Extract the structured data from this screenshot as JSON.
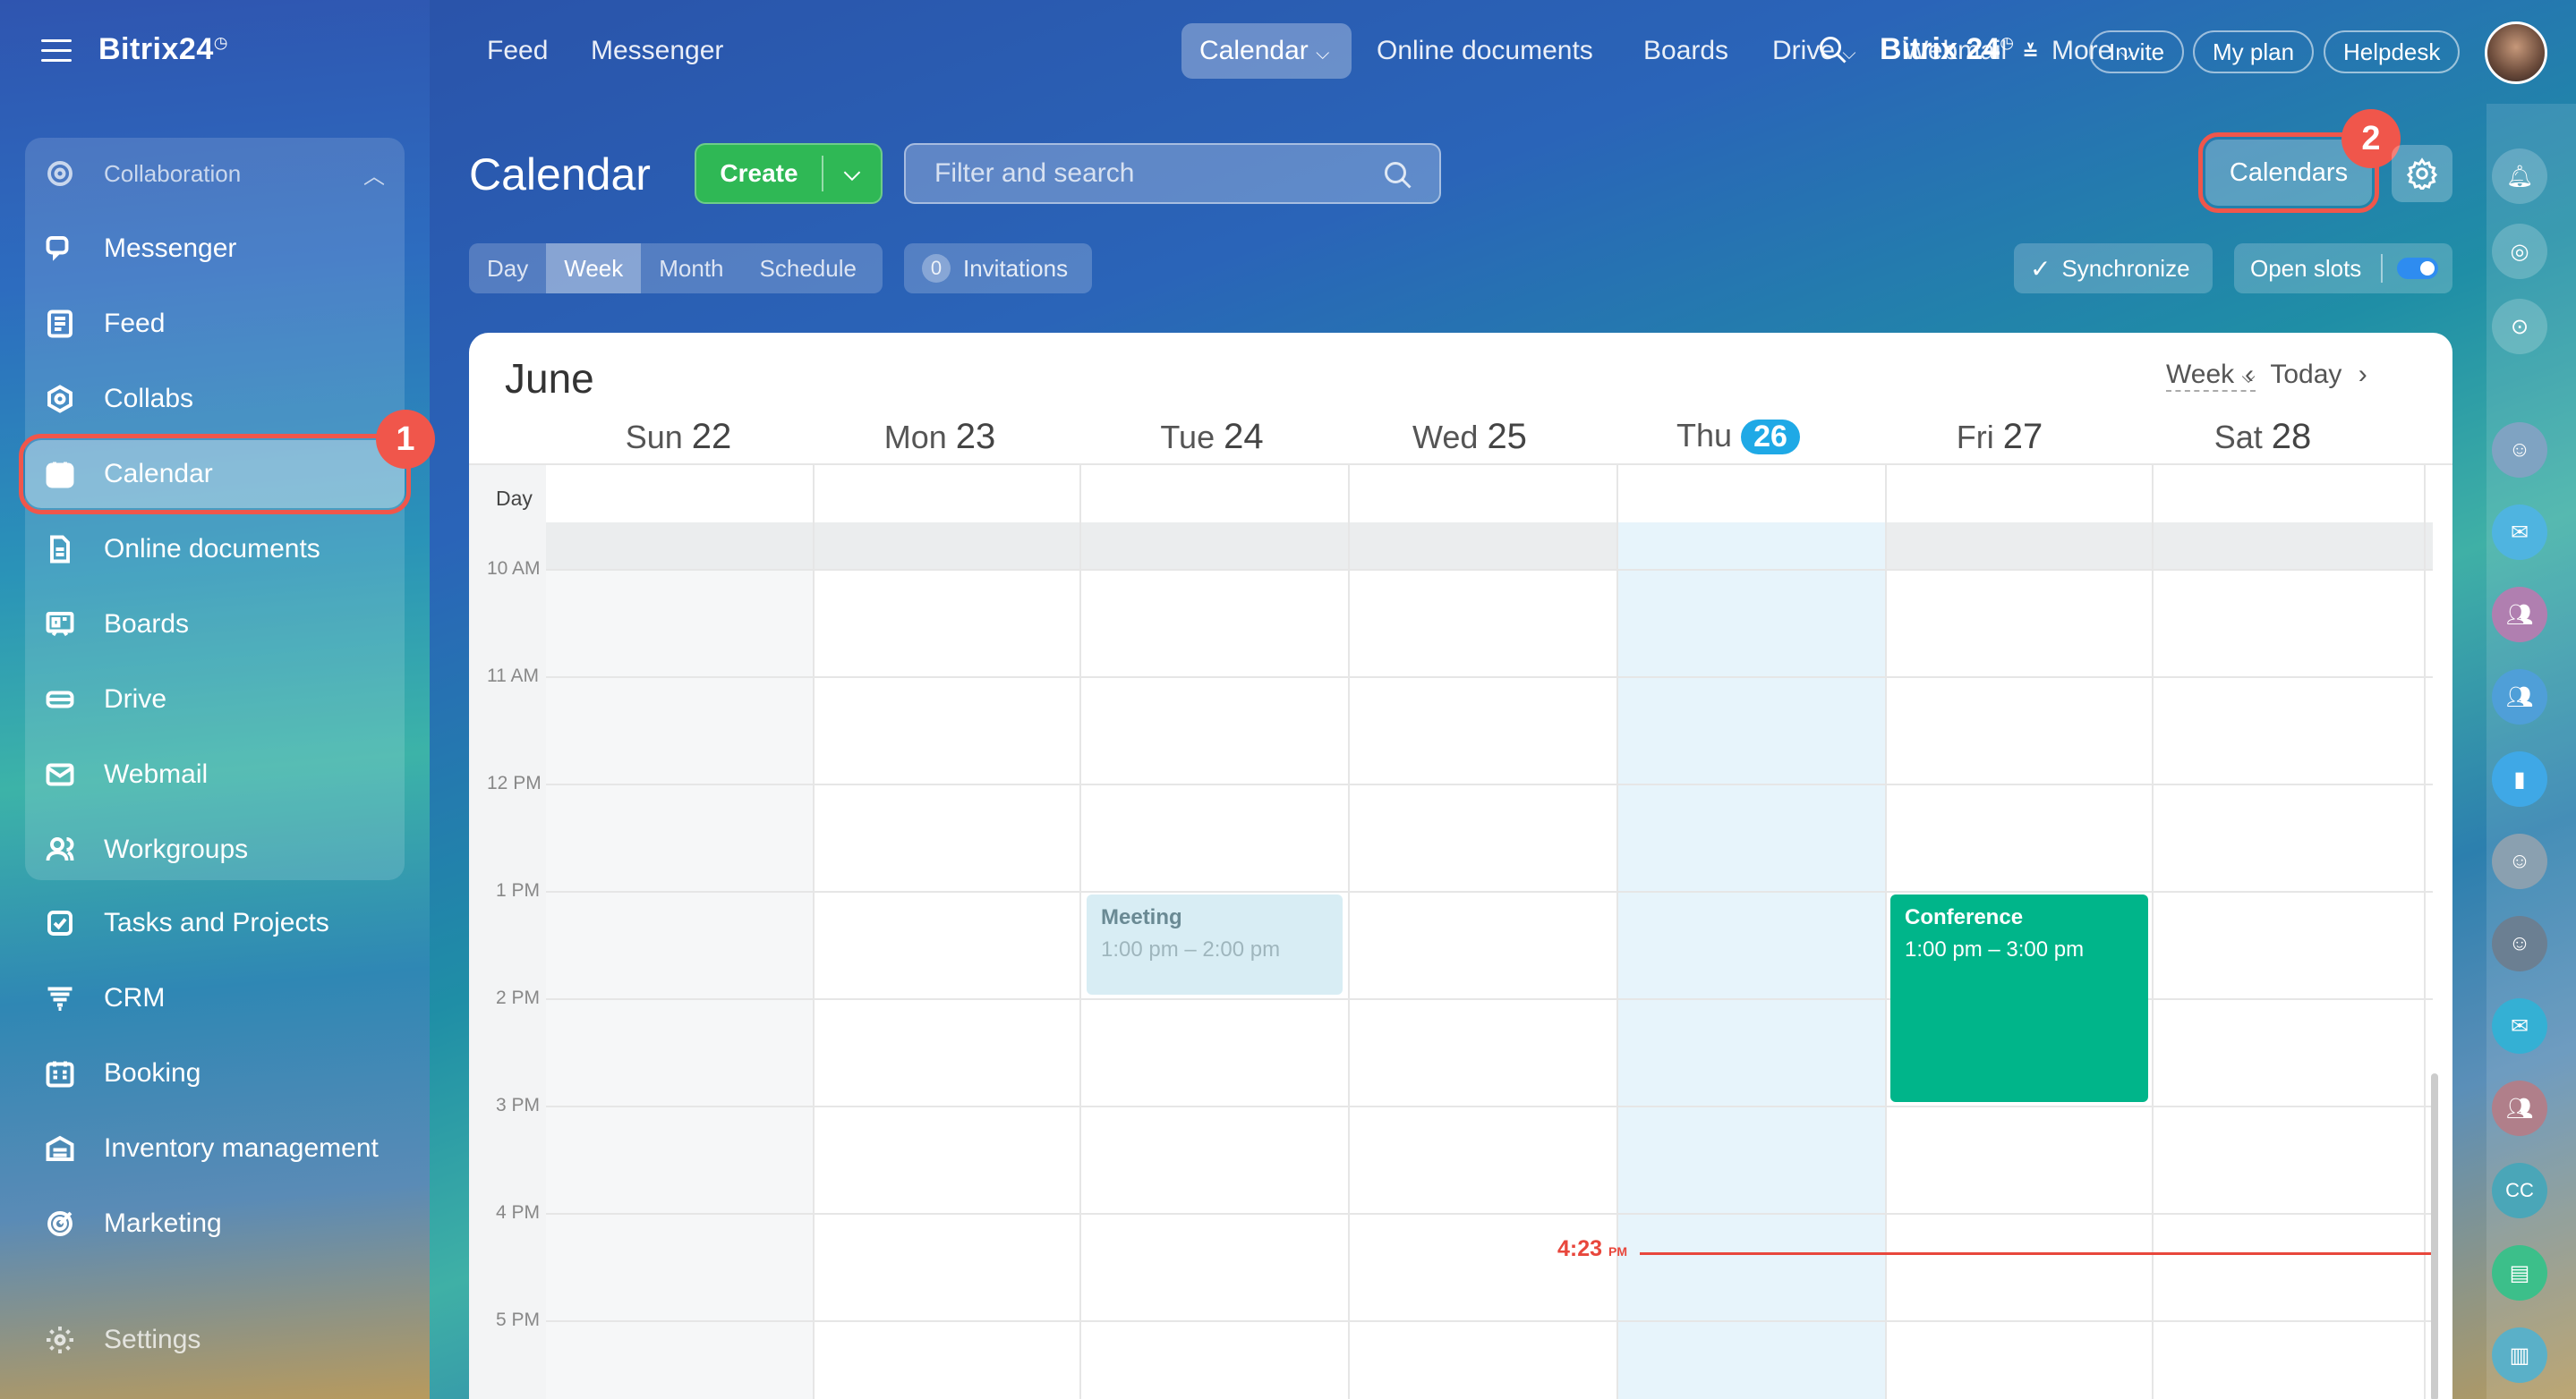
{
  "app": {
    "brand": "Bitrix24"
  },
  "top_nav": {
    "links": [
      "Feed",
      "Messenger",
      "Calendar",
      "Online documents",
      "Boards",
      "Drive",
      "Webmail",
      "More"
    ],
    "brand_right": "Bitrix 24",
    "invite": "Invite",
    "my_plan": "My plan",
    "helpdesk": "Helpdesk"
  },
  "sidebar": {
    "group_label": "Collaboration",
    "items": [
      {
        "label": "Messenger",
        "icon": "chat-icon"
      },
      {
        "label": "Feed",
        "icon": "feed-icon"
      },
      {
        "label": "Collabs",
        "icon": "collabs-icon"
      },
      {
        "label": "Calendar",
        "icon": "calendar-icon"
      },
      {
        "label": "Online documents",
        "icon": "document-icon"
      },
      {
        "label": "Boards",
        "icon": "boards-icon"
      },
      {
        "label": "Drive",
        "icon": "drive-icon"
      },
      {
        "label": "Webmail",
        "icon": "mail-icon"
      },
      {
        "label": "Workgroups",
        "icon": "workgroups-icon"
      },
      {
        "label": "Tasks and Projects",
        "icon": "tasks-icon"
      },
      {
        "label": "CRM",
        "icon": "crm-icon"
      },
      {
        "label": "Booking",
        "icon": "booking-icon"
      },
      {
        "label": "Inventory management",
        "icon": "inventory-icon"
      },
      {
        "label": "Marketing",
        "icon": "marketing-icon"
      },
      {
        "label": "Settings",
        "icon": "settings-icon"
      }
    ]
  },
  "badges": {
    "one": "1",
    "two": "2"
  },
  "header": {
    "title": "Calendar",
    "create": "Create",
    "search_placeholder": "Filter and search",
    "calendars": "Calendars",
    "views": [
      "Day",
      "Week",
      "Month",
      "Schedule"
    ],
    "active_view": "Week",
    "invitations_count": "0",
    "invitations": "Invitations",
    "synchronize": "Synchronize",
    "open_slots": "Open slots"
  },
  "calendar": {
    "month": "June",
    "view_select": "Week",
    "today": "Today",
    "day_row_label": "Day",
    "days": [
      {
        "dow": "Sun",
        "num": "22"
      },
      {
        "dow": "Mon",
        "num": "23"
      },
      {
        "dow": "Tue",
        "num": "24"
      },
      {
        "dow": "Wed",
        "num": "25"
      },
      {
        "dow": "Thu",
        "num": "26"
      },
      {
        "dow": "Fri",
        "num": "27"
      },
      {
        "dow": "Sat",
        "num": "28"
      }
    ],
    "hours": [
      "10 AM",
      "11 AM",
      "12 PM",
      "1 PM",
      "2 PM",
      "3 PM",
      "4 PM",
      "5 PM"
    ],
    "events": [
      {
        "title": "Meeting",
        "time": "1:00 pm – 2:00 pm",
        "day": "Tue 24"
      },
      {
        "title": "Conference",
        "time": "1:00 pm – 3:00 pm",
        "day": "Fri 27"
      }
    ],
    "now_time": "4:23",
    "now_suffix": "PM"
  },
  "colors": {
    "accent_green": "#2fb855",
    "highlight_red": "#f0564b",
    "today_blue": "#1fa9e6",
    "conference": "#00b58a"
  }
}
